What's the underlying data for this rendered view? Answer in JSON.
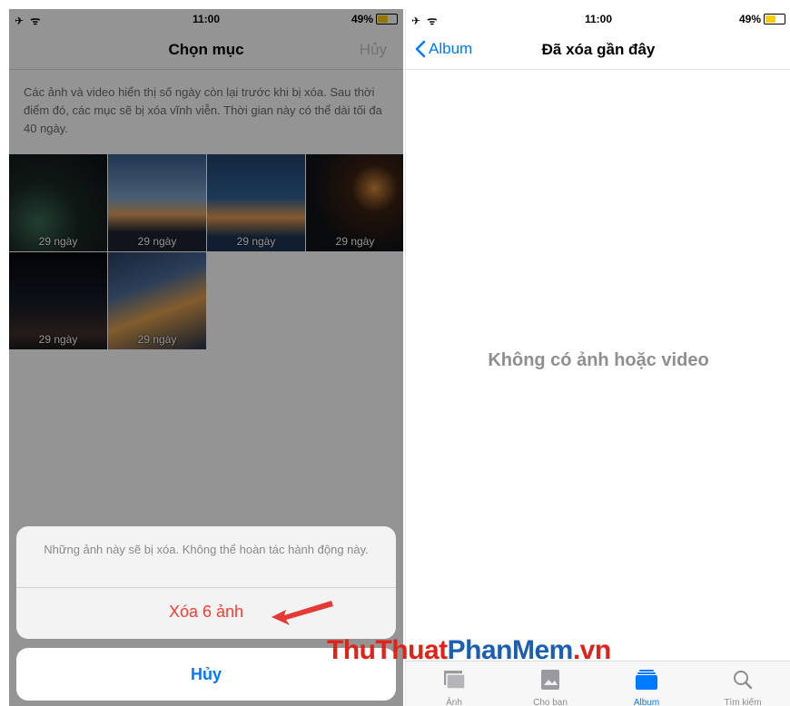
{
  "left": {
    "status": {
      "icons": "✈ ᯤ",
      "time": "11:00",
      "battery": "49%"
    },
    "nav": {
      "title": "Chọn mục",
      "cancel": "Hủy"
    },
    "info": "Các ảnh và video hiển thị số ngày còn lại trước khi bị xóa. Sau thời điểm đó, các mục sẽ bị xóa vĩnh viễn. Thời gian này có thể dài tối đa 40 ngày.",
    "photos": [
      {
        "days": "29 ngày"
      },
      {
        "days": "29 ngày"
      },
      {
        "days": "29 ngày"
      },
      {
        "days": "29 ngày"
      },
      {
        "days": "29 ngày"
      },
      {
        "days": "29 ngày"
      }
    ],
    "sheet": {
      "message": "Những ảnh này sẽ bị xóa. Không thể hoàn tác hành động này.",
      "delete_label": "Xóa 6 ảnh"
    },
    "cancel_label": "Hủy"
  },
  "right": {
    "status": {
      "icons": "✈ ᯤ",
      "time": "11:00",
      "battery": "49%"
    },
    "nav": {
      "back": "Album",
      "title": "Đã xóa gần đây"
    },
    "empty": "Không có ảnh hoặc video",
    "tabs": [
      {
        "label": "Ảnh",
        "icon": "photos-icon"
      },
      {
        "label": "Cho bạn",
        "icon": "for-you-icon"
      },
      {
        "label": "Album",
        "icon": "albums-icon"
      },
      {
        "label": "Tìm kiếm",
        "icon": "search-icon"
      }
    ]
  },
  "watermark": {
    "part1": "ThuThuat",
    "part2": "PhanMem",
    "part3": ".vn"
  },
  "colors": {
    "accent": "#007aff",
    "destructive": "#ff3b30",
    "arrow": "#e53935"
  }
}
